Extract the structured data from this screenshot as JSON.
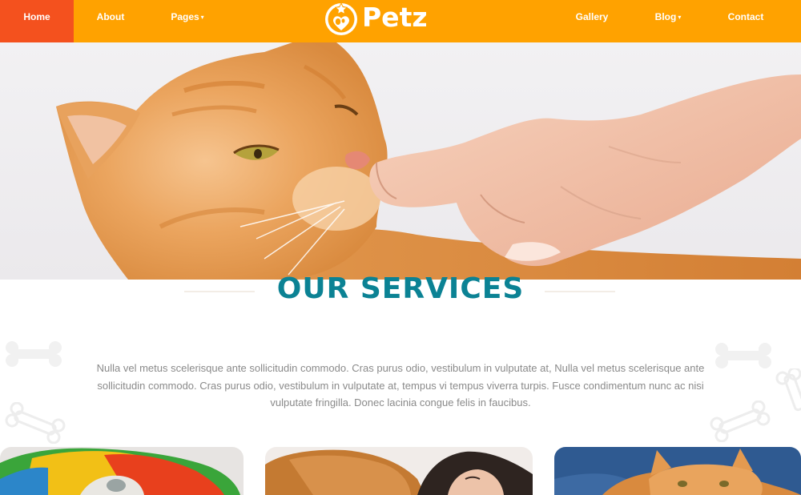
{
  "nav": {
    "items": [
      {
        "label": "Home",
        "active": true
      },
      {
        "label": "About"
      },
      {
        "label": "Pages",
        "dropdown": true
      },
      {
        "label": "Gallery"
      },
      {
        "label": "Blog",
        "dropdown": true
      },
      {
        "label": "Contact"
      }
    ],
    "caret": "▾"
  },
  "logo": {
    "text": "Petz",
    "icon": "paw-heart-star-icon"
  },
  "hero": {
    "image": "orange-cat-finger-photo"
  },
  "services": {
    "title": "OUR SERVICES",
    "description": "Nulla vel metus scelerisque ante sollicitudin commodo. Cras purus odio, vestibulum in vulputate at, Nulla vel metus scelerisque ante sollicitudin commodo. Cras purus odio, vestibulum in vulputate at, tempus vi tempus viverra turpis. Fusce condimentum nunc ac nisi vulputate fringilla. Donec lacinia congue felis in faucibus."
  },
  "cards": [
    {
      "image": "parrot-photo"
    },
    {
      "image": "dog-and-woman-photo"
    },
    {
      "image": "orange-cat-photo"
    }
  ],
  "colors": {
    "nav_bg": "#ffa200",
    "nav_active": "#f4511e",
    "title": "#0b8294",
    "body_text": "#8a8a8a"
  }
}
